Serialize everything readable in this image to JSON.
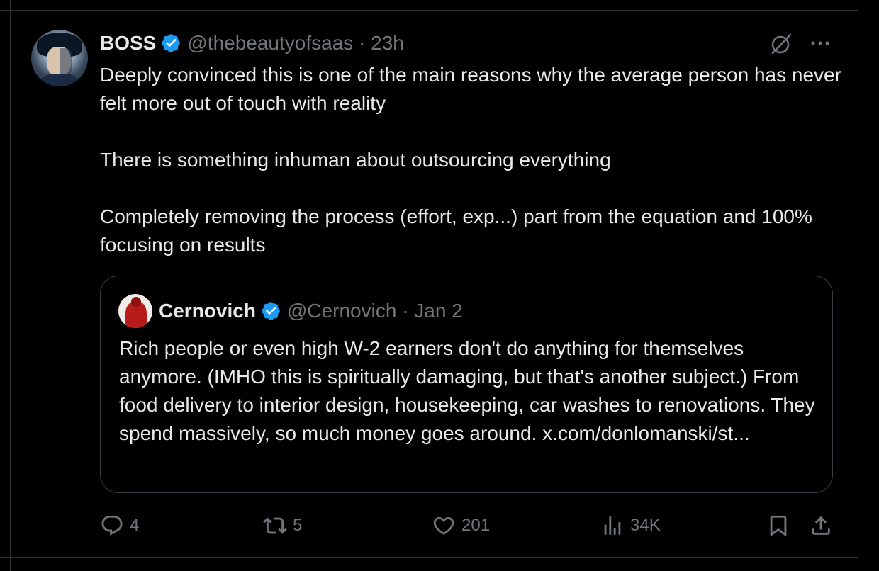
{
  "post": {
    "author_name": "BOSS",
    "author_handle_time": "@thebeautyofsaas · 23h",
    "text": "Deeply convinced this is one of the main reasons why the average person has never felt more out of touch with reality\n\nThere is something inhuman about outsourcing everything\n\nCompletely removing the process (effort, exp...) part from the equation and 100% focusing on results",
    "verified": true
  },
  "quote": {
    "author_name": "Cernovich",
    "author_handle_time": "@Cernovich · Jan 2",
    "text": "Rich people or even high W-2 earners don't do anything for themselves anymore. (IMHO this is spiritually damaging, but that's another subject.) From food delivery to interior design, housekeeping, car washes to renovations. They spend massively, so much money goes around. x.com/donlomanski/st...",
    "verified": true
  },
  "actions": {
    "replies": "4",
    "reposts": "5",
    "likes": "201",
    "views": "34K"
  },
  "colors": {
    "background": "#000000",
    "text": "#e7e9ea",
    "muted": "#71767b",
    "verified": "#1d9bf0",
    "border": "#2f3336"
  },
  "icons": [
    "verified-badge-icon",
    "grok-icon",
    "more-icon",
    "reply-icon",
    "repost-icon",
    "like-icon",
    "views-icon",
    "bookmark-icon",
    "share-icon"
  ]
}
